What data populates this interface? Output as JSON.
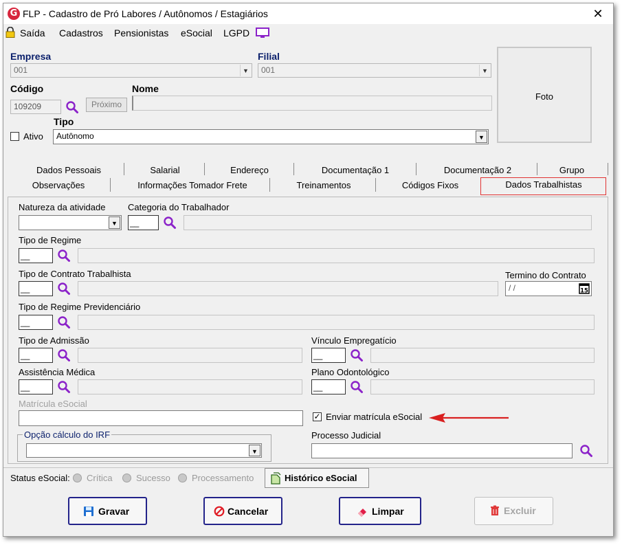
{
  "window": {
    "title": "FLP - Cadastro de Pró Labores / Autônomos / Estagiários",
    "close_label": "✕"
  },
  "menu": {
    "items": [
      "Saída",
      "Cadastros",
      "Pensionistas",
      "eSocial",
      "LGPD"
    ]
  },
  "header": {
    "empresa_label": "Empresa",
    "empresa_value": "001",
    "filial_label": "Filial",
    "filial_value": "001",
    "codigo_label": "Código",
    "codigo_value": "109209",
    "proximo_label": "Próximo",
    "nome_label": "Nome",
    "nome_value": "",
    "tipo_label": "Tipo",
    "tipo_value": "Autônomo",
    "ativo_label": "Ativo",
    "ativo_checked": false,
    "foto_label": "Foto"
  },
  "tabs": {
    "row1": [
      "Dados Pessoais",
      "Salarial",
      "Endereço",
      "Documentação 1",
      "Documentação 2",
      "Grupo"
    ],
    "row2": [
      "Observações",
      "Informações Tomador Frete",
      "Treinamentos",
      "Códigos Fixos",
      "Dados Trabalhistas"
    ],
    "active": "Dados Trabalhistas"
  },
  "form": {
    "natureza_label": "Natureza da atividade",
    "categoria_label": "Categoria do Trabalhador",
    "tipo_regime_label": "Tipo de Regime",
    "tipo_contrato_label": "Tipo de Contrato Trabalhista",
    "termino_label": "Termino do Contrato",
    "termino_value": " / /",
    "regime_prev_label": "Tipo de Regime Previdenciário",
    "tipo_admissao_label": "Tipo de Admissão",
    "vinculo_label": "Vínculo Empregatício",
    "assistencia_label": "Assistência Médica",
    "plano_label": "Plano Odontológico",
    "matricula_label": "Matrícula eSocial",
    "enviar_label": "Enviar matrícula eSocial",
    "enviar_checked": true,
    "opcao_irf_label": "Opção cálculo do IRF",
    "processo_label": "Processo Judicial",
    "code_placeholder": "__"
  },
  "status": {
    "label": "Status eSocial:",
    "options": [
      "Crítica",
      "Sucesso",
      "Processamento"
    ],
    "historico_label": "Histórico eSocial"
  },
  "buttons": {
    "gravar": "Gravar",
    "cancelar": "Cancelar",
    "limpar": "Limpar",
    "excluir": "Excluir"
  },
  "colors": {
    "label_navy": "#0a1f6b",
    "highlight_red": "#e03131",
    "search_icon": "#8b22c9",
    "button_border": "#23238a"
  },
  "icons": [
    "lock-icon",
    "screen-icon",
    "search-icon",
    "calendar-icon",
    "floppy-icon",
    "cancel-icon",
    "eraser-icon",
    "trash-icon",
    "document-icon",
    "red-arrow"
  ]
}
